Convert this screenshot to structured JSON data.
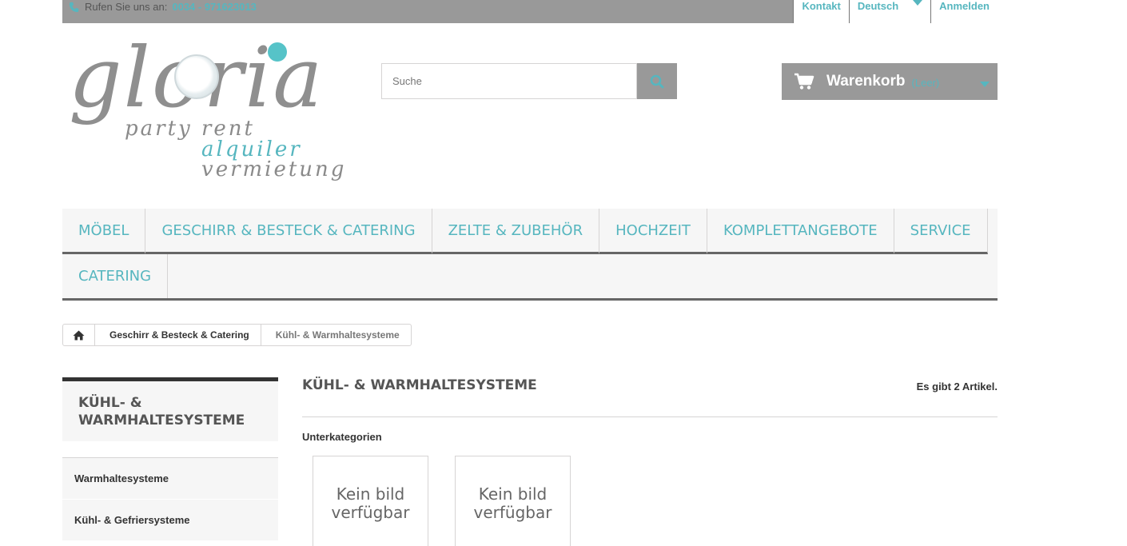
{
  "topbar": {
    "phone_prefix": "Rufen Sie uns an:",
    "phone_number": "0034 - 971623013",
    "contact_label": "Kontakt",
    "language_label": "Deutsch",
    "login_label": "Anmelden"
  },
  "logo": {
    "word": "gloria",
    "line1": "party rent",
    "line2": "alquiler",
    "line3": "vermietung"
  },
  "search": {
    "placeholder": "Suche"
  },
  "cart": {
    "label": "Warenkorb",
    "empty": "(Leer)"
  },
  "menu": {
    "items": [
      "MÖBEL",
      "GESCHIRR & BESTECK & CATERING",
      "ZELTE & ZUBEHÖR",
      "HOCHZEIT",
      "KOMPLETTANGEBOTE",
      "SERVICE",
      "CATERING"
    ]
  },
  "breadcrumb": {
    "crumb1": "Geschirr & Besteck & Catering",
    "crumb2": "Kühl- & Warmhaltesysteme"
  },
  "sidebar": {
    "title_line1": "KÜHL- &",
    "title_line2": "WARMHALTESYSTEME",
    "items": [
      "Warmhaltesysteme",
      "Kühl- & Gefriersysteme"
    ]
  },
  "main": {
    "title": "KÜHL- & WARMHALTESYSTEME",
    "count": "Es gibt 2 Artikel.",
    "subcategories_label": "Unterkategorien",
    "no_image_line1": "Kein bild",
    "no_image_line2": "verfügbar"
  },
  "colors": {
    "accent": "#56b6bf",
    "gray_bar": "#999999",
    "menu_bg": "#f6f6f6"
  }
}
